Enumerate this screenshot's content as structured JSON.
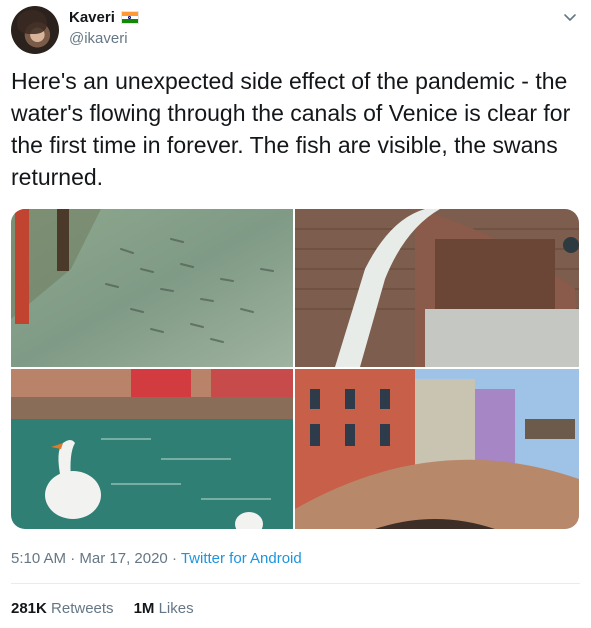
{
  "author": {
    "display_name": "Kaveri",
    "handle": "@ikaveri",
    "flag_icon": "india-flag-icon"
  },
  "tweet": {
    "text": "Here's an unexpected side effect of the pandemic - the water's flowing through the canals of Venice is clear for the first time in forever. The fish are visible, the swans returned."
  },
  "media": [
    {
      "icon": "photo-canal-fish"
    },
    {
      "icon": "photo-bridge-arch"
    },
    {
      "icon": "photo-swan-canal"
    },
    {
      "icon": "photo-venice-bridge"
    }
  ],
  "meta": {
    "time": "5:10 AM",
    "separator": " · ",
    "date": "Mar 17, 2020",
    "source": "Twitter for Android"
  },
  "stats": {
    "retweets_count": "281K",
    "retweets_label": "Retweets",
    "likes_count": "1M",
    "likes_label": "Likes"
  },
  "colors": {
    "link": "#1b95e0",
    "secondary_text": "#657786",
    "primary_text": "#14171a"
  }
}
